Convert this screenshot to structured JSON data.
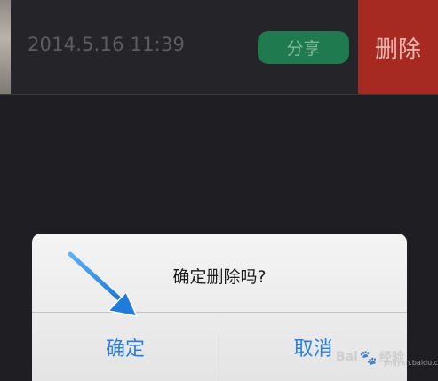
{
  "list_row": {
    "timestamp": "2014.5.16 11:39",
    "share_label": "分享",
    "delete_label": "删除"
  },
  "dialog": {
    "message": "确定删除吗?",
    "confirm_label": "确定",
    "cancel_label": "取消"
  },
  "colors": {
    "background": "#1f1e23",
    "share_green": "#1f7a50",
    "delete_red": "#a62a22",
    "dialog_button_blue": "#2a7de1",
    "arrow_blue": "#2d8ee6"
  },
  "watermark": {
    "brand": "Bai",
    "brand_tail": "经验",
    "domain": "jingyan.baidu.com"
  }
}
